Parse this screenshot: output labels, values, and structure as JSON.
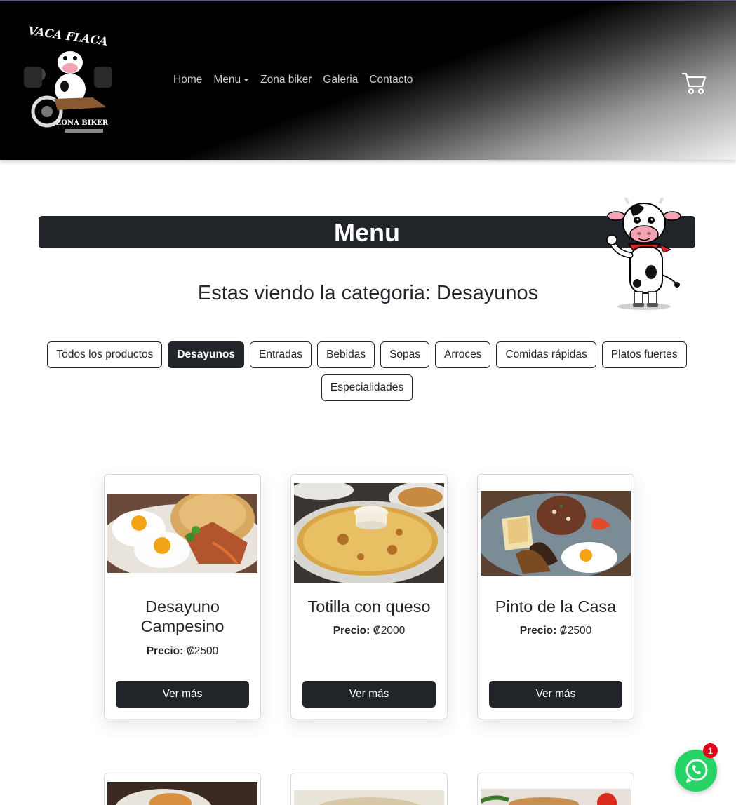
{
  "header": {
    "logo_text_top": "VACA FLACA",
    "logo_text_bottom": "ZONA BIKER",
    "nav": [
      {
        "label": "Home"
      },
      {
        "label": "Menu"
      },
      {
        "label": "Zona biker"
      },
      {
        "label": "Galeria"
      },
      {
        "label": "Contacto"
      }
    ],
    "cart_icon": "shopping-cart-icon"
  },
  "page": {
    "title": "Menu",
    "subtitle": "Estas viendo la categoria: Desayunos"
  },
  "categories": [
    {
      "label": "Todos los productos",
      "active": false
    },
    {
      "label": "Desayunos",
      "active": true
    },
    {
      "label": "Entradas",
      "active": false
    },
    {
      "label": "Bebidas",
      "active": false
    },
    {
      "label": "Sopas",
      "active": false
    },
    {
      "label": "Arroces",
      "active": false
    },
    {
      "label": "Comidas rápidas",
      "active": false
    },
    {
      "label": "Platos fuertes",
      "active": false
    },
    {
      "label": "Especialidades",
      "active": false
    }
  ],
  "products": [
    {
      "name": "Desayuno Campesino",
      "price_label": "Precio:",
      "price": "₡2500",
      "button": "Ver más"
    },
    {
      "name": "Totilla con queso",
      "price_label": "Precio:",
      "price": "₡2000",
      "button": "Ver más"
    },
    {
      "name": "Pinto de la Casa",
      "price_label": "Precio:",
      "price": "₡2500",
      "button": "Ver más"
    }
  ],
  "whatsapp": {
    "badge": "1",
    "icon": "whatsapp-icon"
  },
  "colors": {
    "dark": "#212529",
    "whatsapp": "#25d366",
    "badge": "#e3001b"
  }
}
